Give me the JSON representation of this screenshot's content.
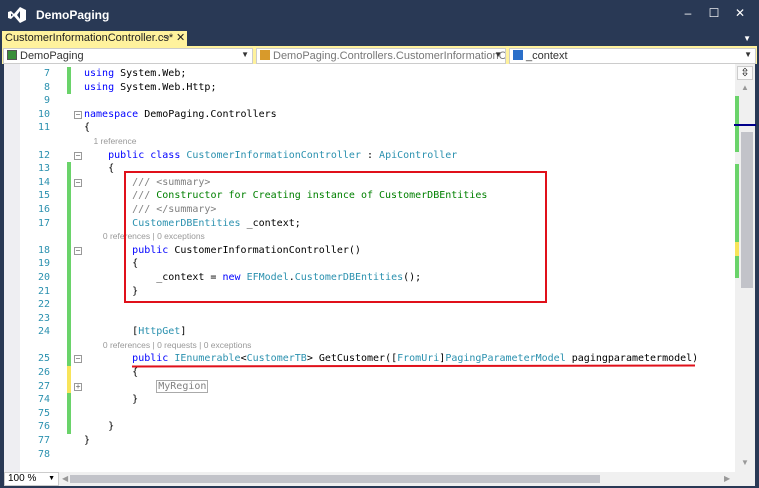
{
  "window": {
    "title": "DemoPaging",
    "minimize": "‒",
    "maximize": "☐",
    "close": "✕"
  },
  "tab": {
    "label": "CustomerInformationController.cs*",
    "pin": "⊸",
    "close": "✕",
    "overflow": "▼"
  },
  "navbar": {
    "project": "DemoPaging",
    "class": "DemoPaging.Controllers.CustomerInformationContr",
    "member": "_context",
    "dropdown": "▼"
  },
  "colors": {
    "accent_tab": "#fff29d",
    "frame": "#293955",
    "changed": "#6ad36a",
    "unsaved": "#f8e45a",
    "highlight": "#e0101a"
  },
  "code": {
    "rows": [
      {
        "n": "7",
        "t": [
          [
            "kw",
            "using"
          ],
          [
            "pl",
            " System.Web;"
          ]
        ],
        "chg": "g"
      },
      {
        "n": "8",
        "t": [
          [
            "kw",
            "using"
          ],
          [
            "pl",
            " System.Web.Http;"
          ]
        ],
        "chg": "g"
      },
      {
        "n": "9",
        "t": []
      },
      {
        "n": "10",
        "fold": "−",
        "t": [
          [
            "kw",
            "namespace"
          ],
          [
            "pl",
            " DemoPaging.Controllers"
          ]
        ]
      },
      {
        "n": "11",
        "t": [
          [
            "pl",
            "{"
          ]
        ]
      },
      {
        "lens": "    1 reference"
      },
      {
        "n": "12",
        "fold": "−",
        "t": [
          [
            "pl",
            "    "
          ],
          [
            "kw",
            "public class"
          ],
          [
            "pl",
            " "
          ],
          [
            "ty",
            "CustomerInformationController"
          ],
          [
            "pl",
            " : "
          ],
          [
            "ty",
            "ApiController"
          ]
        ]
      },
      {
        "n": "13",
        "t": [
          [
            "pl",
            "    {"
          ]
        ],
        "chg": "g"
      },
      {
        "n": "14",
        "fold": "−",
        "t": [
          [
            "doc",
            "        /// <summary>"
          ]
        ],
        "chg": "g"
      },
      {
        "n": "15",
        "t": [
          [
            "doc",
            "        ///"
          ],
          [
            "cm",
            " Constructor for Creating instance of CustomerDBEntities"
          ]
        ],
        "chg": "g"
      },
      {
        "n": "16",
        "t": [
          [
            "doc",
            "        /// </summary>"
          ]
        ],
        "chg": "g"
      },
      {
        "n": "17",
        "t": [
          [
            "pl",
            "        "
          ],
          [
            "ty",
            "CustomerDBEntities"
          ],
          [
            "pl",
            " _context;"
          ]
        ],
        "chg": "g"
      },
      {
        "lens": "        0 references | 0 exceptions",
        "chg": "g"
      },
      {
        "n": "18",
        "fold": "−",
        "t": [
          [
            "pl",
            "        "
          ],
          [
            "kw",
            "public"
          ],
          [
            "pl",
            " CustomerInformationController()"
          ]
        ],
        "chg": "g"
      },
      {
        "n": "19",
        "t": [
          [
            "pl",
            "        {"
          ]
        ],
        "chg": "g"
      },
      {
        "n": "20",
        "t": [
          [
            "pl",
            "            _context = "
          ],
          [
            "kw",
            "new"
          ],
          [
            "pl",
            " "
          ],
          [
            "ty",
            "EFModel"
          ],
          [
            "pl",
            "."
          ],
          [
            "ty",
            "CustomerDBEntities"
          ],
          [
            "pl",
            "();"
          ]
        ],
        "chg": "g"
      },
      {
        "n": "21",
        "t": [
          [
            "pl",
            "        }"
          ]
        ],
        "chg": "g"
      },
      {
        "n": "22",
        "t": [],
        "chg": "g"
      },
      {
        "n": "23",
        "t": [],
        "chg": "g"
      },
      {
        "n": "24",
        "t": [
          [
            "pl",
            "        ["
          ],
          [
            "ty",
            "HttpGet"
          ],
          [
            "pl",
            "]"
          ]
        ],
        "chg": "g"
      },
      {
        "lens": "        0 references | 0 requests | 0 exceptions",
        "chg": "g"
      },
      {
        "n": "25",
        "fold": "−",
        "t": [
          [
            "pl",
            "        "
          ],
          [
            "kw",
            "public"
          ],
          [
            "pl",
            " "
          ],
          [
            "ty",
            "IEnumerable"
          ],
          [
            "pl",
            "<"
          ],
          [
            "ty",
            "CustomerTB"
          ],
          [
            "pl",
            "> GetCustomer(["
          ],
          [
            "ty",
            "FromUri"
          ],
          [
            "pl",
            "]"
          ],
          [
            "ty",
            "PagingParameterModel"
          ],
          [
            "pl",
            " pagingparametermodel)"
          ]
        ],
        "chg": "g"
      },
      {
        "n": "26",
        "t": [
          [
            "pl",
            "        {"
          ]
        ],
        "chg": "y"
      },
      {
        "n": "27",
        "fold": "+",
        "t": [
          [
            "pl",
            "            "
          ],
          [
            "region",
            "MyRegion"
          ]
        ],
        "chg": "y"
      },
      {
        "n": "74",
        "t": [
          [
            "pl",
            "        }"
          ]
        ],
        "chg": "g"
      },
      {
        "n": "75",
        "t": [],
        "chg": "g"
      },
      {
        "n": "76",
        "t": [
          [
            "pl",
            "    }"
          ]
        ],
        "chg": "g"
      },
      {
        "n": "77",
        "t": [
          [
            "pl",
            "}"
          ]
        ]
      },
      {
        "n": "78",
        "t": []
      }
    ]
  },
  "scrollbar": {
    "split_icon": "⇳",
    "up": "▲",
    "down": "▼",
    "left": "◀",
    "right": "▶"
  },
  "status": {
    "zoom": "100 %"
  }
}
